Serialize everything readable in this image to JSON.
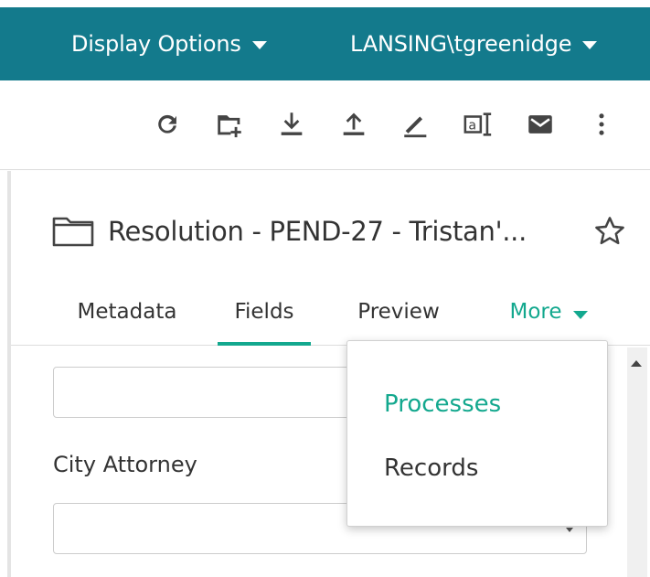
{
  "header": {
    "display_options_label": "Display Options",
    "user_label": "LANSING\\tgreenidge",
    "bg_color": "#137a8c"
  },
  "toolbar": {
    "icons": [
      "refresh-icon",
      "new-folder-icon",
      "download-icon",
      "upload-icon",
      "sign-icon",
      "ocr-icon",
      "email-icon",
      "more-vertical-icon"
    ]
  },
  "panel": {
    "title": "Resolution - PEND-27 - Tristan'...",
    "tabs": {
      "metadata": "Metadata",
      "fields": "Fields",
      "preview": "Preview",
      "more": "More"
    },
    "active_tab": "Fields",
    "accent_color": "#13a88e"
  },
  "form": {
    "first_field_value": "",
    "city_attorney_label": "City Attorney",
    "city_attorney_value": ""
  },
  "more_menu": {
    "items": [
      "Processes",
      "Records"
    ],
    "highlighted": "Processes"
  }
}
